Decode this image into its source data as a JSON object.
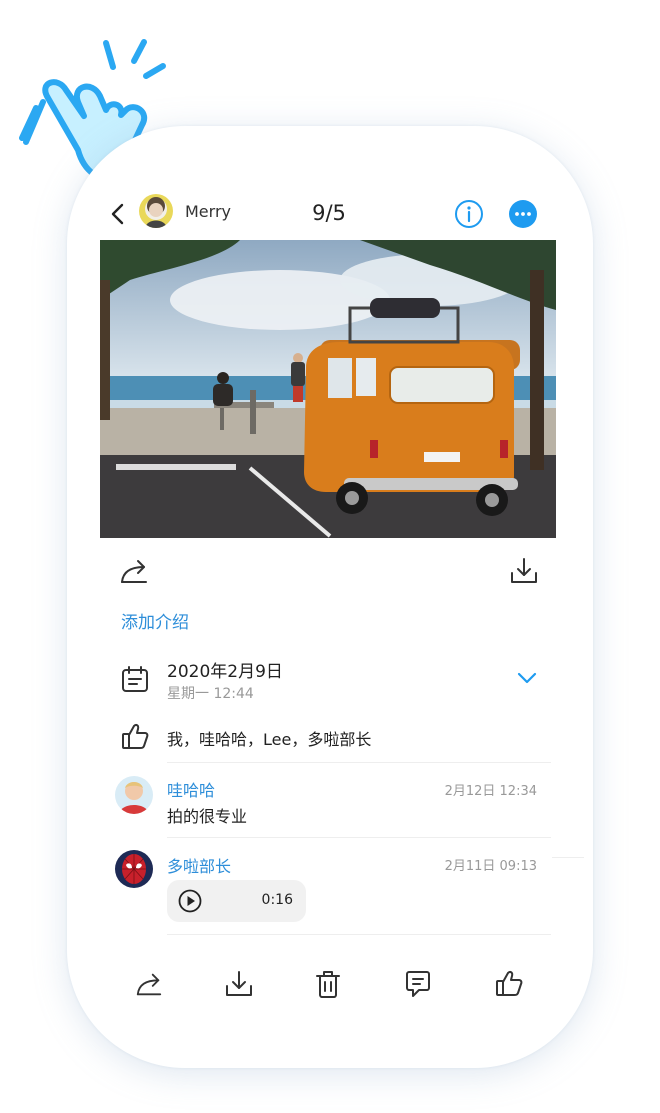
{
  "header": {
    "username": "Merry",
    "counter": "9/5",
    "back_icon": "chevron-left-icon",
    "info_icon": "info-icon",
    "more_icon": "more-icon"
  },
  "colors": {
    "accent": "#1E9BF0",
    "link": "#2E8ED9",
    "hand": "#2BA8F2",
    "hand_fill": "#C7F0FF"
  },
  "actions_top": {
    "share_icon": "share-icon",
    "download_icon": "download-icon"
  },
  "intro_link": "添加介绍",
  "date": {
    "date": "2020年2月9日",
    "weekday": "星期一 12:44"
  },
  "likes": {
    "names": "我，哇哈哈，Lee，多啦部长"
  },
  "comments": [
    {
      "name": "哇哈哈",
      "time": "2月12日 12:34",
      "text": "拍的很专业"
    },
    {
      "name": "多啦部长",
      "time": "2月11日 09:13",
      "voice_duration": "0:16"
    }
  ],
  "bottom_bar": [
    "share-icon",
    "download-icon",
    "delete-icon",
    "comment-icon",
    "like-icon"
  ]
}
